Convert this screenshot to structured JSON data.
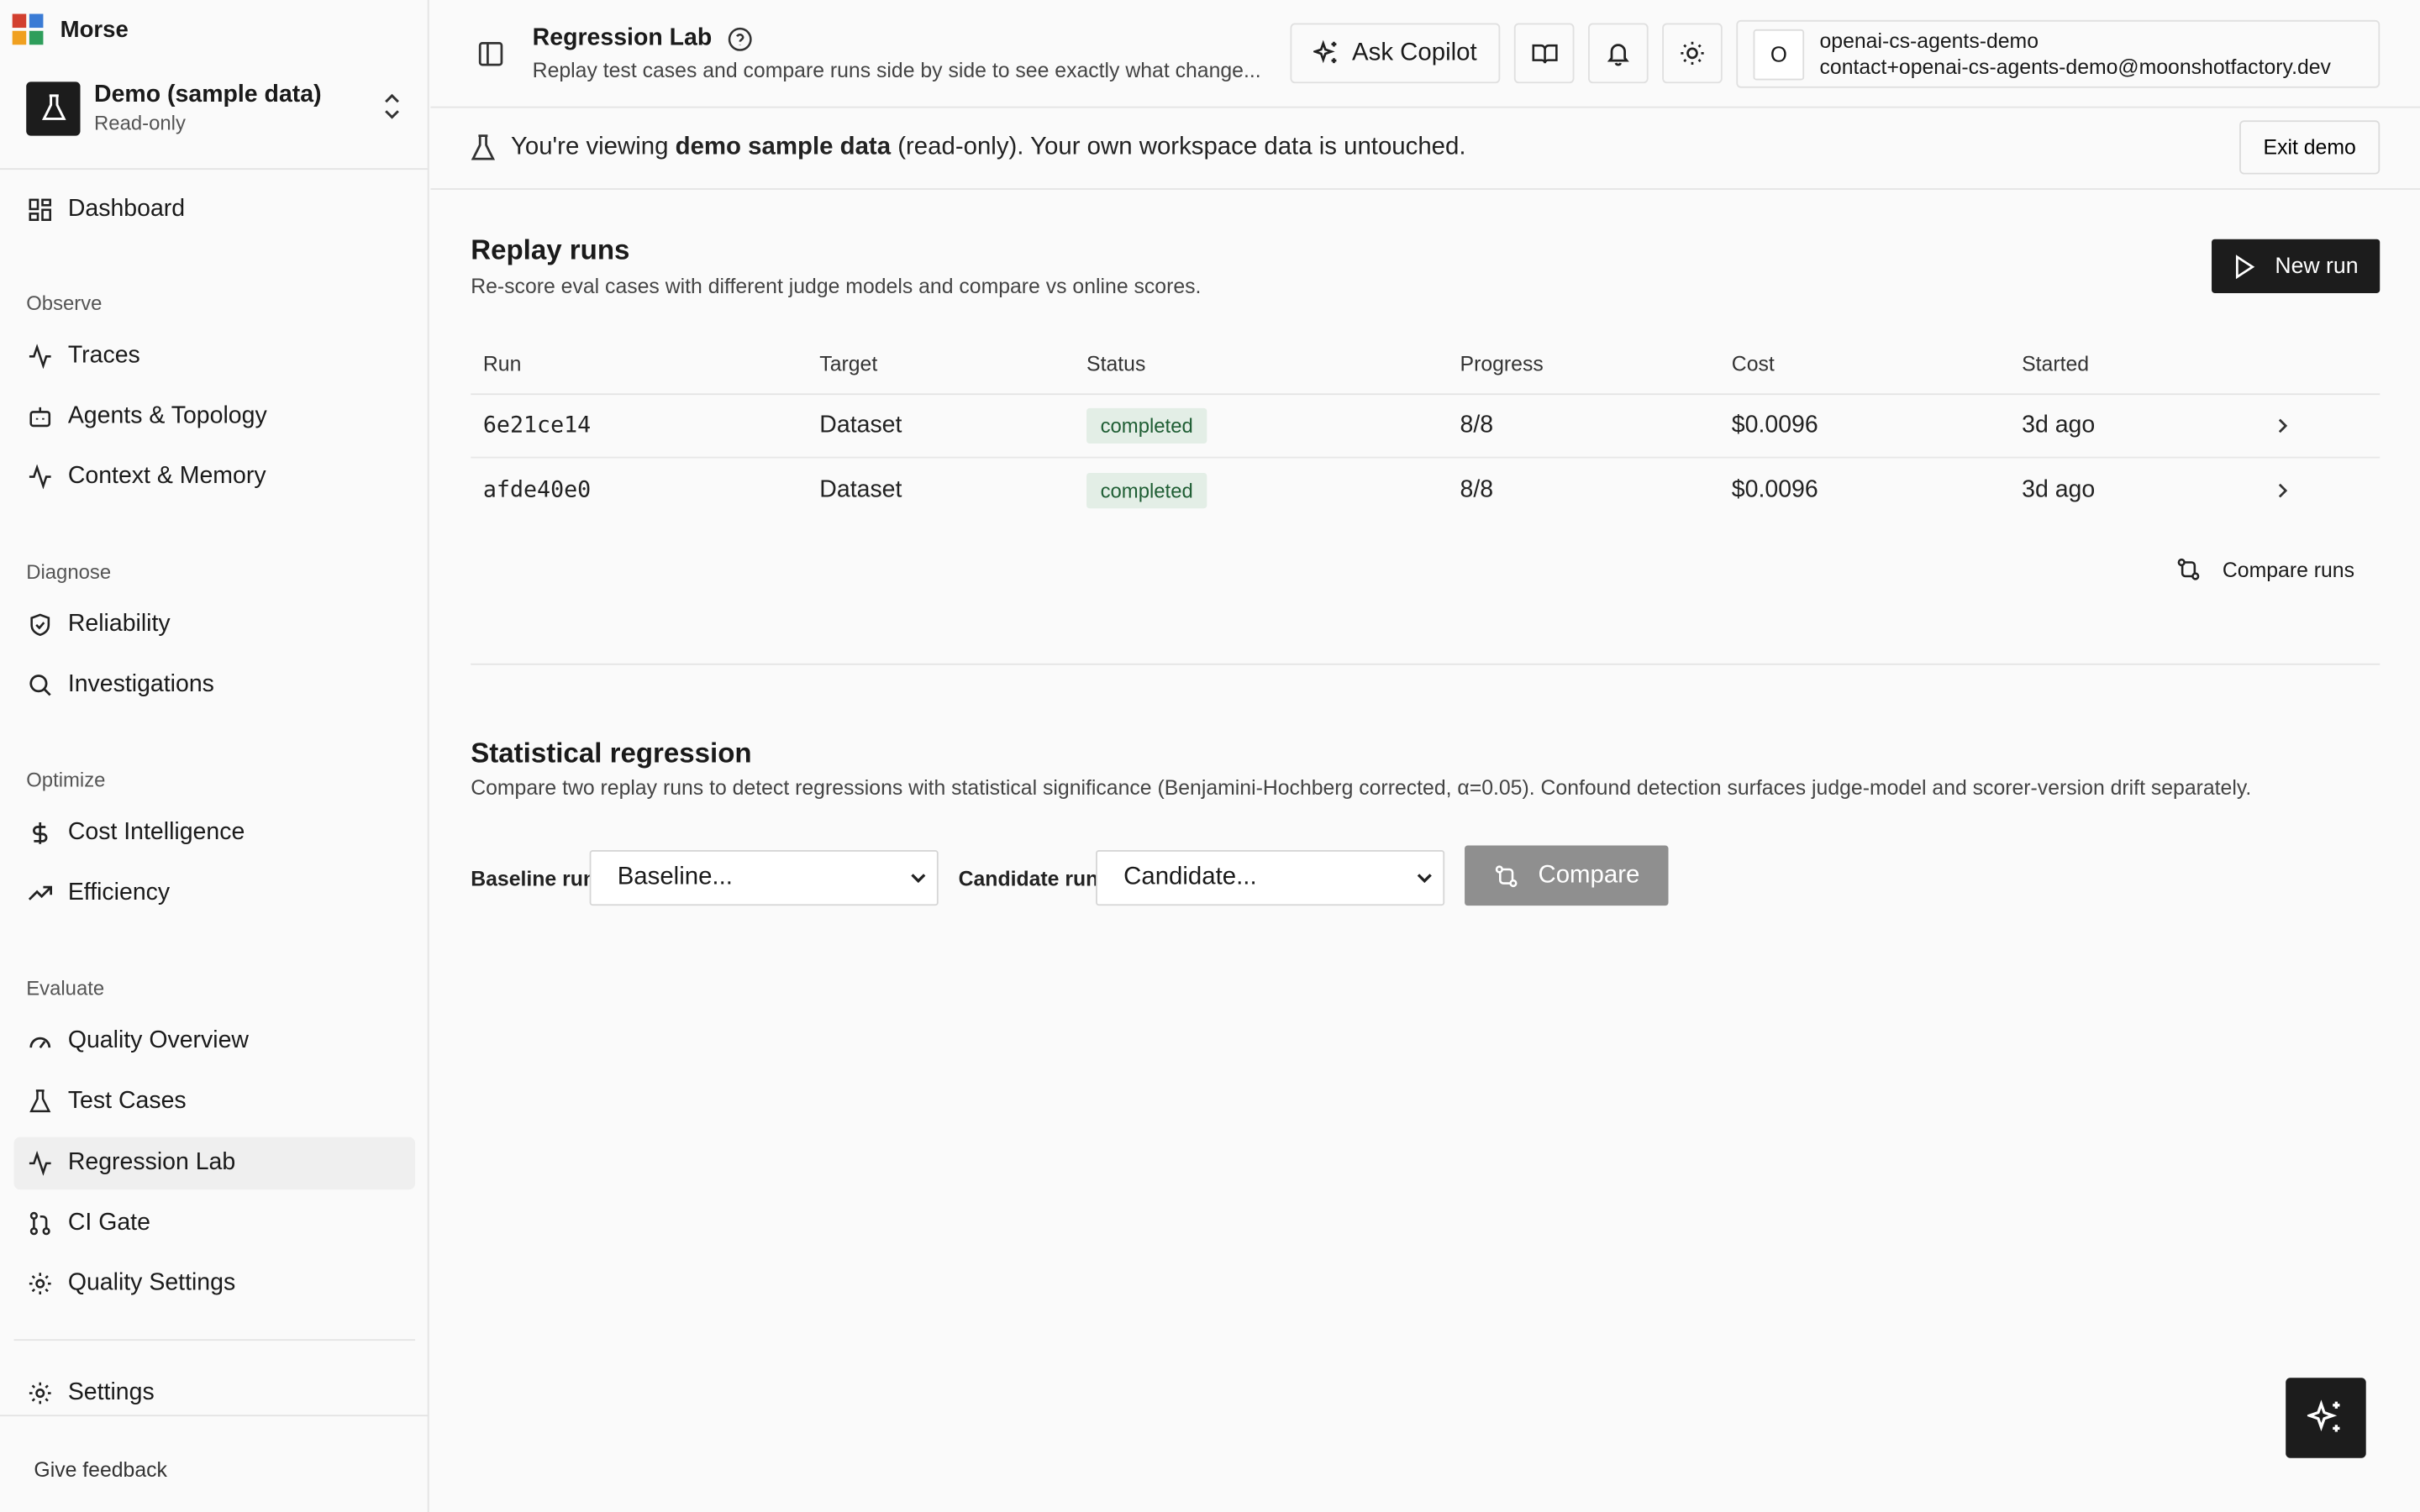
{
  "brand": {
    "name": "Morse",
    "logo_colors": [
      "#d23f2f",
      "#3a7bd5",
      "#f0a020",
      "#2e9e5b"
    ]
  },
  "workspace": {
    "title": "Demo (sample data)",
    "subtitle": "Read-only"
  },
  "sidebar": {
    "dashboard": "Dashboard",
    "sections": {
      "observe": "Observe",
      "diagnose": "Diagnose",
      "optimize": "Optimize",
      "evaluate": "Evaluate"
    },
    "items": {
      "traces": "Traces",
      "agents": "Agents & Topology",
      "context": "Context & Memory",
      "reliability": "Reliability",
      "investigations": "Investigations",
      "cost": "Cost Intelligence",
      "efficiency": "Efficiency",
      "quality_overview": "Quality Overview",
      "test_cases": "Test Cases",
      "regression_lab": "Regression Lab",
      "ci_gate": "CI Gate",
      "quality_settings": "Quality Settings",
      "settings": "Settings"
    },
    "active_item": "Regression Lab",
    "feedback": "Give feedback"
  },
  "header": {
    "title": "Regression Lab",
    "subtitle": "Replay test cases and compare runs side by side to see exactly what change...",
    "copilot_label": "Ask Copilot",
    "user": {
      "initial": "O",
      "name": "openai-cs-agents-demo",
      "email": "contact+openai-cs-agents-demo@moonshotfactory.dev"
    }
  },
  "banner": {
    "prefix": "You're viewing ",
    "bold": "demo sample data",
    "suffix": " (read-only). Your own workspace data is untouched.",
    "exit_label": "Exit demo"
  },
  "replay": {
    "title": "Replay runs",
    "description": "Re-score eval cases with different judge models and compare vs online scores.",
    "new_run_label": "New run",
    "columns": {
      "run": "Run",
      "target": "Target",
      "status": "Status",
      "progress": "Progress",
      "cost": "Cost",
      "started": "Started"
    },
    "rows": [
      {
        "run": "6e21ce14",
        "target": "Dataset",
        "status": "completed",
        "progress": "8/8",
        "cost": "$0.0096",
        "started": "3d ago"
      },
      {
        "run": "afde40e0",
        "target": "Dataset",
        "status": "completed",
        "progress": "8/8",
        "cost": "$0.0096",
        "started": "3d ago"
      }
    ],
    "compare_runs_label": "Compare runs"
  },
  "statistical": {
    "title": "Statistical regression",
    "description": "Compare two replay runs to detect regressions with statistical significance (Benjamini-Hochberg corrected, α=0.05). Confound detection surfaces judge-model and scorer-version drift separately.",
    "baseline_label": "Baseline run",
    "baseline_value": "Baseline...",
    "candidate_label": "Candidate run",
    "candidate_value": "Candidate...",
    "compare_label": "Compare"
  },
  "colors": {
    "badge_bg": "#e3eee6",
    "badge_text": "#1f5e34",
    "primary_button": "#1c1c1c",
    "disabled_button": "#8f8f8f"
  }
}
